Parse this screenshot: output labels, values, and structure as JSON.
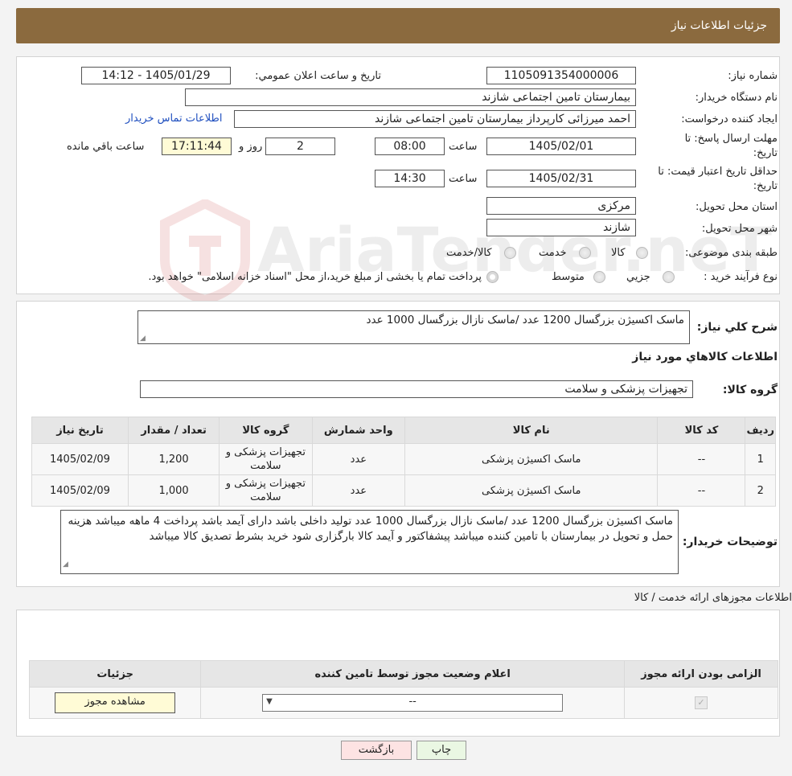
{
  "header": {
    "title": "جزئیات اطلاعات نیاز"
  },
  "form": {
    "need_number_label": "شماره نیاز:",
    "need_number": "1105091354000006",
    "announce_label": "تاریخ و ساعت اعلان عمومي:",
    "announce_value": "1405/01/29 - 14:12",
    "buyer_org_label": "نام دستگاه خریدار:",
    "buyer_org": "بیمارستان تامین اجتماعی شازند",
    "creator_label": "ایجاد کننده درخواست:",
    "creator": "احمد میرزائی کارپرداز بیمارستان تامین اجتماعی شازند",
    "contact_link": "اطلاعات تماس خریدار",
    "deadline_label_1": "مهلت ارسال پاسخ: تا",
    "deadline_label_2": "تاریخ:",
    "deadline_date": "1405/02/01",
    "time_label": "ساعت",
    "deadline_time": "08:00",
    "days": "2",
    "days_label": "روز و",
    "remaining_time": "17:11:44",
    "remaining_label": "ساعت باقي مانده",
    "validity_label_1": "حداقل تاریخ اعتبار قیمت: تا",
    "validity_label_2": "تاریخ:",
    "validity_date": "1405/02/31",
    "validity_time": "14:30",
    "province_label": "استان محل تحویل:",
    "province": "مرکزی",
    "city_label": "شهر محل تحویل:",
    "city": "شازند",
    "category_label": "طبقه بندی موضوعی:",
    "category_options": [
      "کالا",
      "خدمت",
      "کالا/خدمت"
    ],
    "process_label": "نوع فرآیند خرید :",
    "process_options": [
      "جزیي",
      "متوسط"
    ],
    "process_note": "پرداخت تمام یا بخشی از مبلغ خرید،از محل \"اسناد خزانه اسلامی\" خواهد بود."
  },
  "summary": {
    "label": "شرح کلي نیاز:",
    "text": "ماسک اکسیژن بزرگسال 1200 عدد /ماسک نازال بزرگسال 1000 عدد",
    "goods_info_title": "اطلاعات کالاهاي مورد نیاز",
    "goods_group_label": "گروه کالا:",
    "goods_group": "تجهیزات پزشکی و سلامت"
  },
  "items_table": {
    "headers": [
      "ردیف",
      "کد کالا",
      "نام کالا",
      "واحد شمارش",
      "گروه کالا",
      "تعداد / مقدار",
      "تاریخ نیاز"
    ],
    "rows": [
      [
        "1",
        "--",
        "ماسک اکسیژن پزشکی",
        "عدد",
        "تجهیزات پزشکی و سلامت",
        "1,200",
        "1405/02/09"
      ],
      [
        "2",
        "--",
        "ماسک اکسیژن پزشکی",
        "عدد",
        "تجهیزات پزشکی و سلامت",
        "1,000",
        "1405/02/09"
      ]
    ]
  },
  "buyer_notes": {
    "label": "توضیحات خریدار:",
    "text": "ماسک اکسیژن بزرگسال 1200 عدد /ماسک نازال بزرگسال 1000 عدد تولید داخلی باشد دارای آیمد باشد پرداخت 4 ماهه میباشد هزینه حمل و تحویل در بیمارستان  با تامین کننده  میباشد پیشفاکتور و آیمد کالا بارگزاری شود  خرید بشرط تصدیق کالا میباشد"
  },
  "permits": {
    "title": "اطلاعات مجوزهای ارائه خدمت / کالا",
    "headers": [
      "الزامی بودن ارائه مجوز",
      "اعلام وضعیت مجوز توسط تامین کننده",
      "جزئیات"
    ],
    "select_value": "--",
    "view_button": "مشاهده مجوز"
  },
  "actions": {
    "print": "چاپ",
    "back": "بازگشت"
  },
  "watermark": {
    "text": "AriaTender.neT"
  },
  "colors": {
    "header_bg": "#8b6a3e",
    "link": "#1f4fbf",
    "back_bg": "#fde3e3",
    "print_bg": "#eaf7e3"
  }
}
